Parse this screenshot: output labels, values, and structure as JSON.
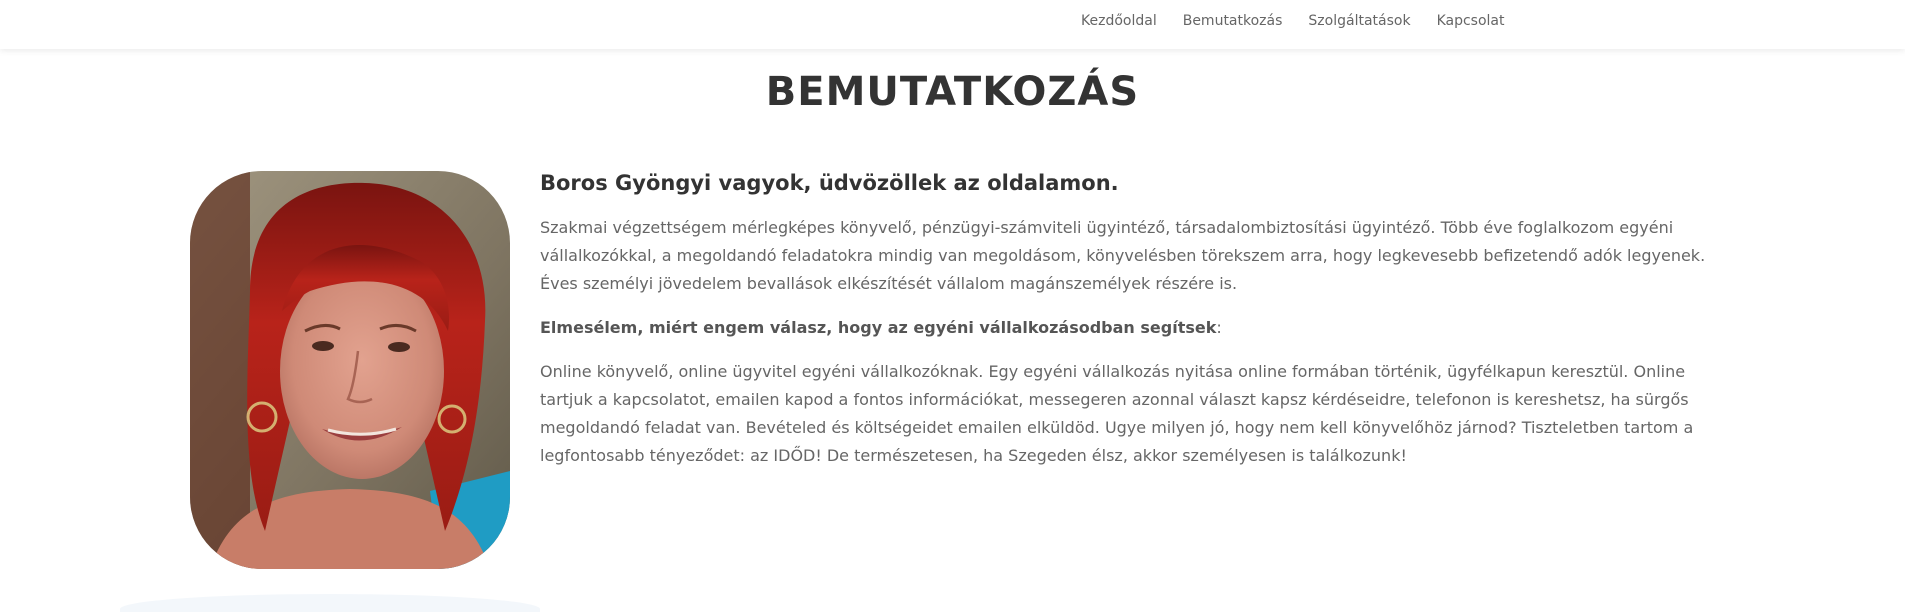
{
  "nav": {
    "items": [
      {
        "label": "Kezdőoldal"
      },
      {
        "label": "Bemutatkozás"
      },
      {
        "label": "Szolgáltatások"
      },
      {
        "label": "Kapcsolat"
      }
    ]
  },
  "page": {
    "title": "BEMUTATKOZÁS"
  },
  "content": {
    "intro": "Boros Gyöngyi vagyok, üdvözöllek az oldalamon.",
    "paragraph1": "Szakmai végzettségem mérlegképes könyvelő, pénzügyi-számviteli ügyintéző, társadalombiztosítási ügyintéző. Több éve foglalkozom egyéni vállalkozókkal, a megoldandó feladatokra mindig van megoldásom, könyvelésben törekszem arra, hogy legkevesebb befizetendő adók legyenek. Éves személyi jövedelem bevallások elkészítését vállalom magánszemélyek részére is.",
    "paragraph2_bold": "Elmesélem, miért engem válasz, hogy az egyéni vállalkozásodban segítsek",
    "paragraph2_suffix": ":",
    "paragraph3": "Online könyvelő, online ügyvitel egyéni vállalkozóknak. Egy egyéni vállalkozás nyitása online formában történik, ügyfélkapun keresztül. Online tartjuk a kapcsolatot, emailen kapod a fontos információkat, messegeren azonnal választ kapsz kérdéseidre, telefonon is kereshetsz, ha sürgős megoldandó feladat van. Bevételed és költségeidet emailen elküldöd. Ugye milyen jó, hogy nem kell könyvelőhöz járnod? Tiszteletben tartom a legfontosabb tényeződet: az IDŐD! De természetesen, ha Szegeden élsz, akkor személyesen is találkozunk!"
  },
  "colors": {
    "heading": "#333333",
    "body_text": "#666666",
    "hair": "#b8231a",
    "photo_background": "#8a7e68"
  }
}
